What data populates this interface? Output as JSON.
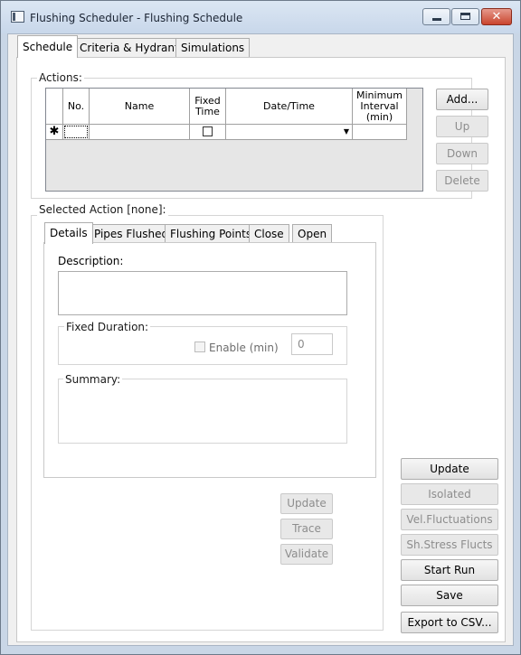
{
  "window": {
    "title": "Flushing Scheduler - Flushing Schedule"
  },
  "tabs": [
    "Schedule",
    "Criteria & Hydrants",
    "Simulations"
  ],
  "actions": {
    "group_label": "Actions:",
    "columns": [
      "No.",
      "Name",
      "Fixed Time",
      "Date/Time",
      "Minimum Interval (min)"
    ],
    "new_row_marker": "✱",
    "buttons": {
      "add": "Add...",
      "up": "Up",
      "down": "Down",
      "delete": "Delete"
    }
  },
  "selected_action": {
    "group_label": "Selected Action [none]:",
    "subtabs": [
      "Details",
      "Pipes Flushed",
      "Flushing Points",
      "Close",
      "Open"
    ],
    "description_label": "Description:",
    "fixed_duration_label": "Fixed Duration:",
    "enable_label": "Enable (min)",
    "duration_value": "0",
    "summary_label": "Summary:",
    "buttons": {
      "update": "Update",
      "trace": "Trace",
      "validate": "Validate"
    }
  },
  "right_buttons": {
    "update": "Update",
    "isolated": "Isolated",
    "vel_fluct": "Vel.Fluctuations",
    "shstress": "Sh.Stress Flucts",
    "start_run": "Start Run",
    "save": "Save",
    "export": "Export to CSV..."
  },
  "colors": {
    "title_bar": "#c8d7ea",
    "close_button": "#c9442d",
    "disabled_text": "#8d8d8d"
  },
  "icons": [
    "app-icon",
    "minimize-icon",
    "maximize-icon",
    "close-icon",
    "new-row-asterisk-icon",
    "dropdown-arrow-icon"
  ]
}
